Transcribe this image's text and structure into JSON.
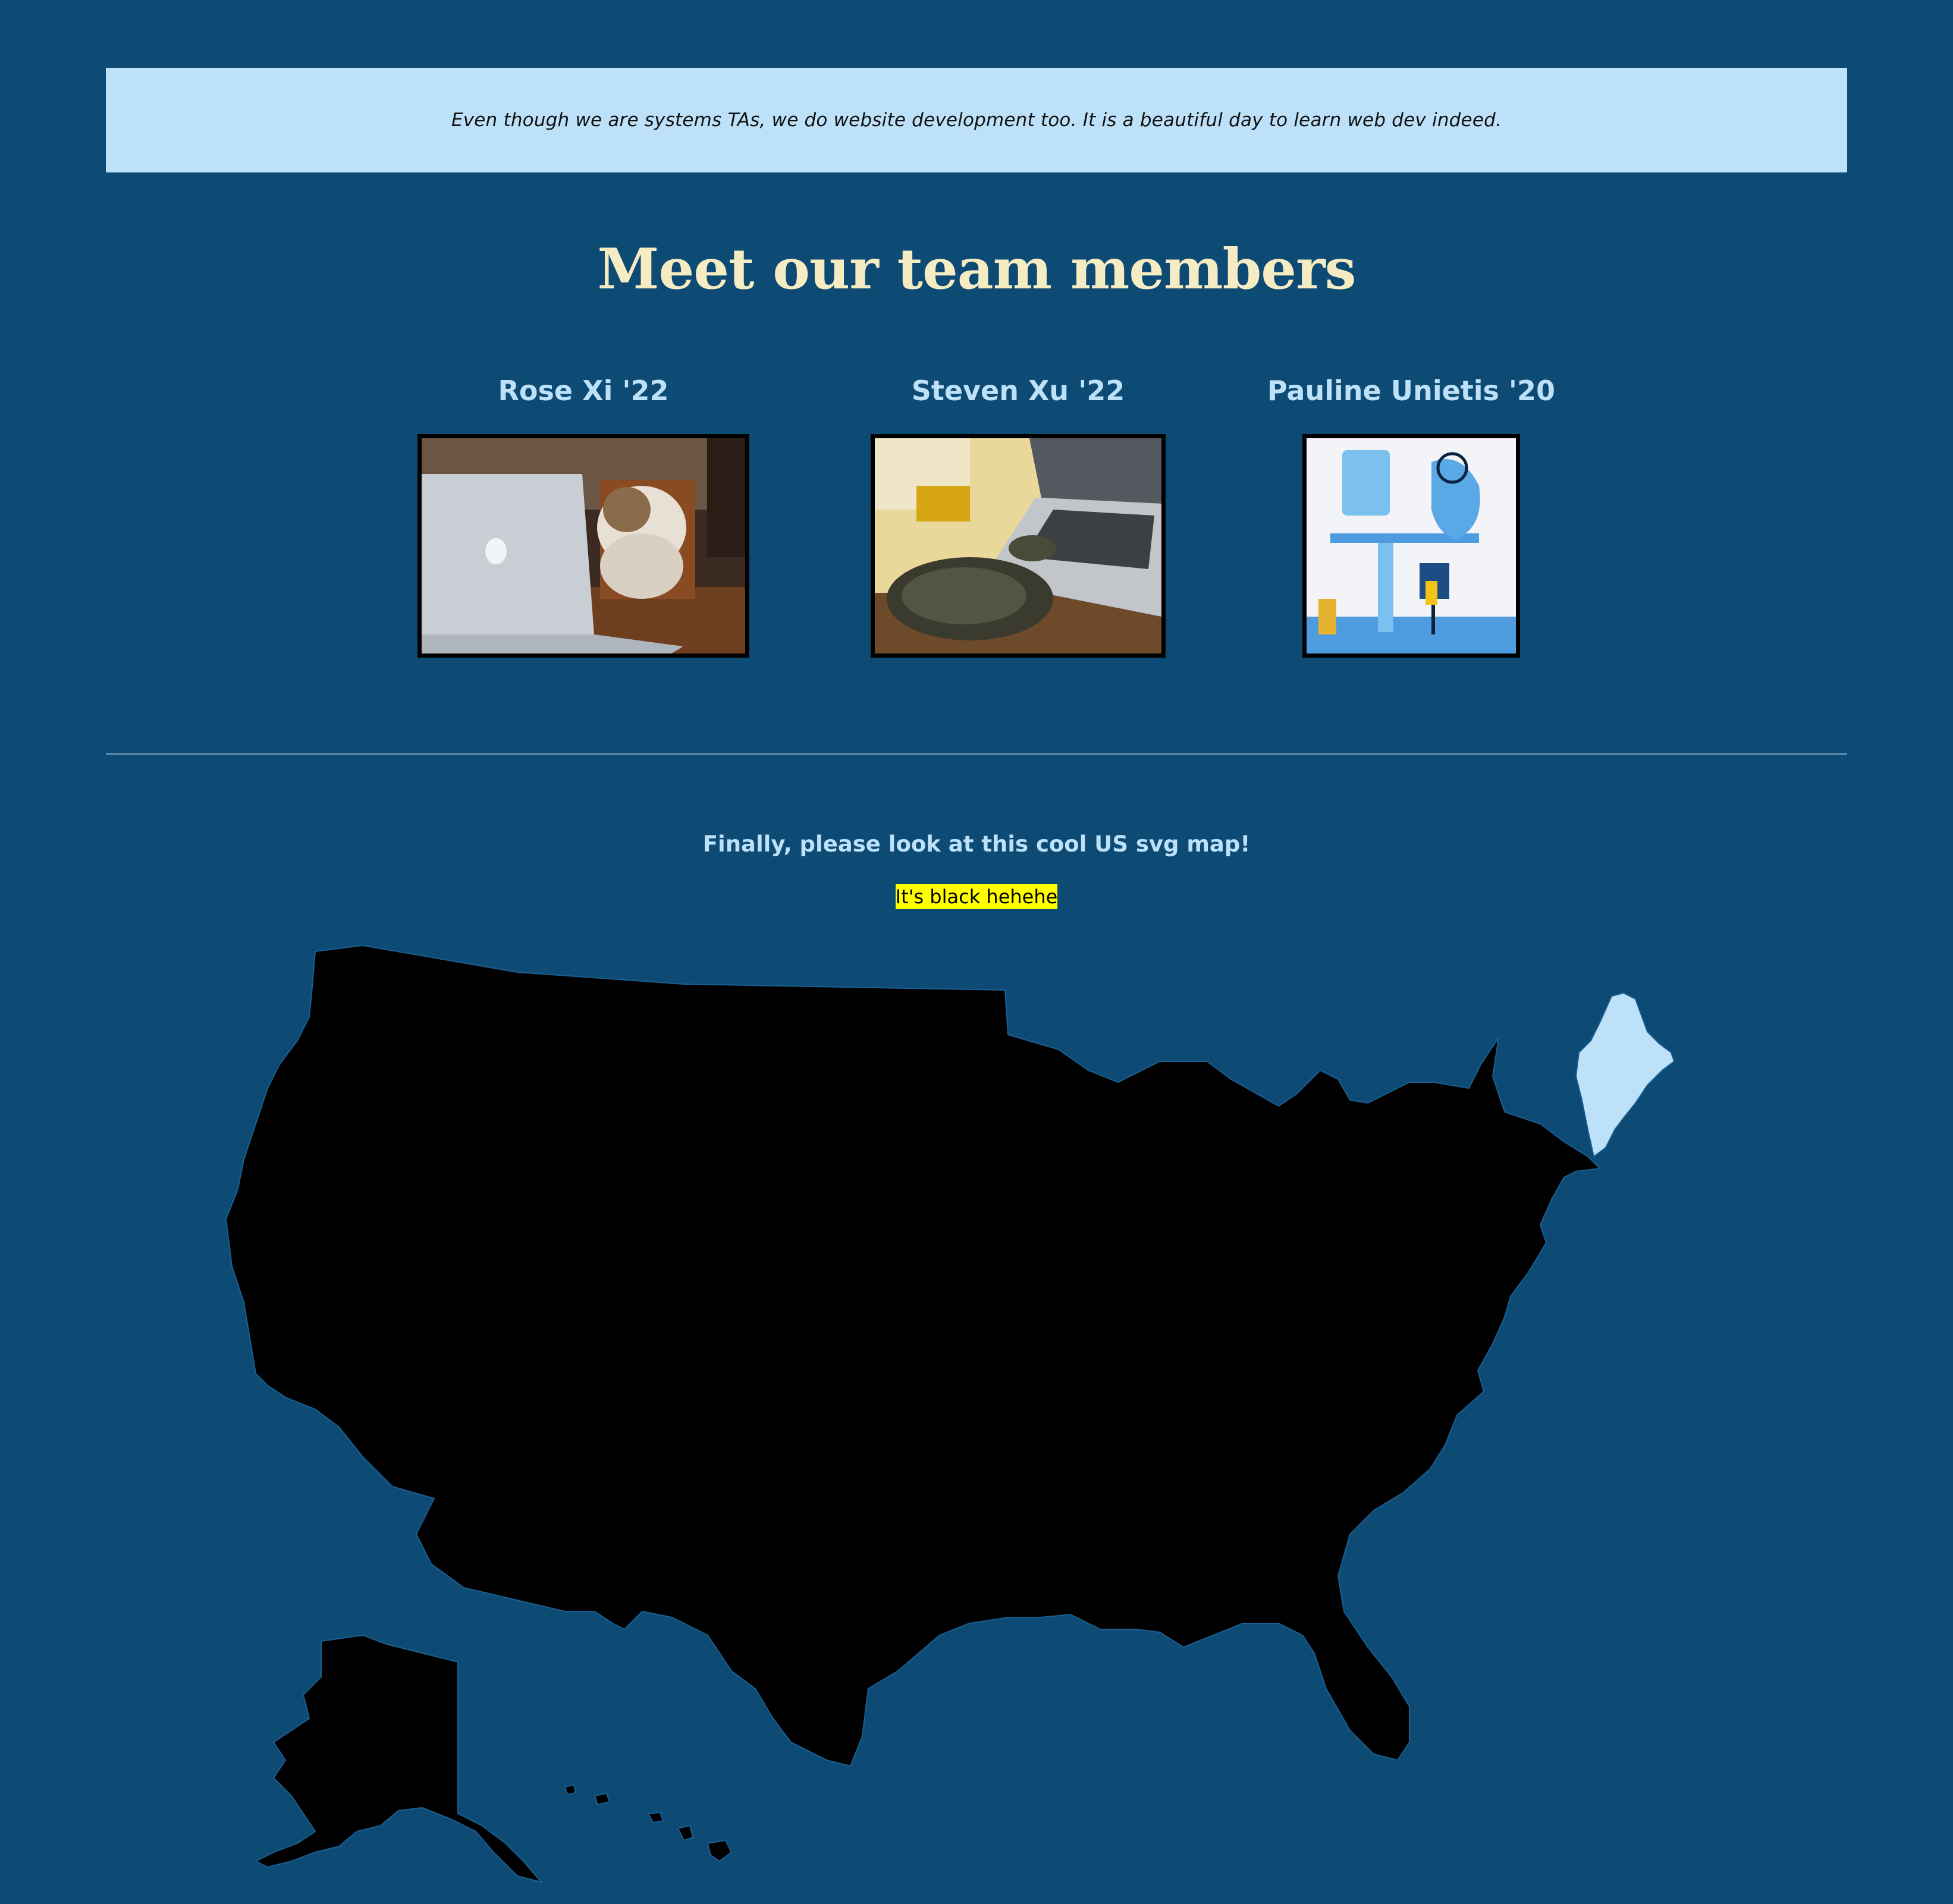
{
  "banner": {
    "text": "Even though we are systems TAs, we do website development too. It is a beautiful day to learn web dev indeed."
  },
  "team": {
    "title": "Meet our team members",
    "members": [
      {
        "name": "Rose Xi '22",
        "photo_icon": "cat-using-laptop-photo"
      },
      {
        "name": "Steven Xu '22",
        "photo_icon": "turtle-on-laptop-photo"
      },
      {
        "name": "Pauline Unietis '20",
        "photo_icon": "dolphin-at-desk-illustration"
      }
    ]
  },
  "map_section": {
    "heading": "Finally, please look at this cool US svg map!",
    "note": "It's black hehehe",
    "colors": {
      "state_fill": "#000000",
      "state_border": "#1b5f92",
      "highlight_fill": "#bde1f8",
      "highlighted_state": "Maine"
    }
  },
  "colors": {
    "page_background": "#0d4a74",
    "banner_background": "#bde1f8",
    "title_color": "#f6ecc3",
    "name_color": "#bde1f8",
    "note_highlight": "#ffff00"
  }
}
